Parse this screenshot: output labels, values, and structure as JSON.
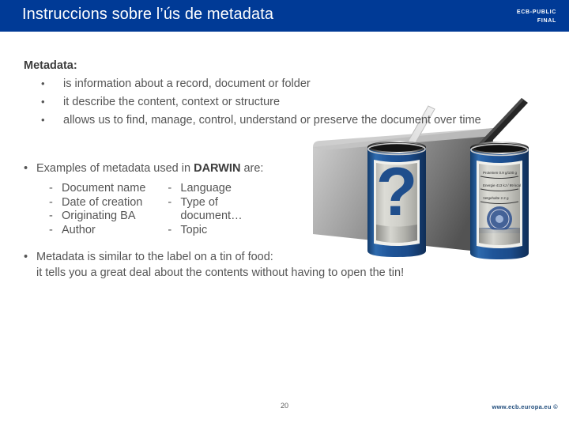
{
  "header": {
    "title": "Instruccions sobre l’ús de metadata",
    "classification_line1": "ECB-PUBLIC",
    "classification_line2": "FINAL",
    "band_color": "#003A96"
  },
  "content": {
    "lead_label": "Metadata:",
    "sub_bullets": [
      {
        "marker": "•",
        "text": "is information about a record, document or folder"
      },
      {
        "marker": "•",
        "text": "it describe the content, context or structure"
      },
      {
        "marker": "•",
        "text": "allows us to find, manage, control, understand or preserve the document over time"
      }
    ],
    "examples_heading": {
      "bullet": "•",
      "prefix": "Examples of metadata used in ",
      "emphasis": "DARWIN",
      "suffix": " are:"
    },
    "examples_columns": [
      {
        "items": [
          {
            "marker": "-",
            "text": "Document name"
          },
          {
            "marker": "-",
            "text": "Date of creation"
          },
          {
            "marker": "-",
            "text": "Originating BA"
          },
          {
            "marker": "-",
            "text": "Author"
          }
        ]
      },
      {
        "items": [
          {
            "marker": "-",
            "text": "Language"
          },
          {
            "marker": "-",
            "text": "Type of"
          },
          {
            "marker": "",
            "text": "document…"
          },
          {
            "marker": "-",
            "text": "Topic"
          }
        ]
      }
    ],
    "closing": {
      "bullet": "•",
      "line1": "Metadata is similar to the label on a tin of food:",
      "line2": "it tells you a great deal about the contents without having to open the tin!"
    }
  },
  "illustration": {
    "name": "two-tin-cans-illustration",
    "left_can_symbol": "?",
    "right_can_label_lines": [
      "Proteinen 0.9 g/100 g",
      "Energie 413 kJ / 99 kcal",
      "Vetgehalte 2.2 g"
    ],
    "can_body_color": "#1F5599",
    "label_color": "#D4D4CE",
    "symbol_color": "#1F4E8C"
  },
  "footer": {
    "page_number": "20",
    "url": "www.ecb.europa.eu ©"
  }
}
